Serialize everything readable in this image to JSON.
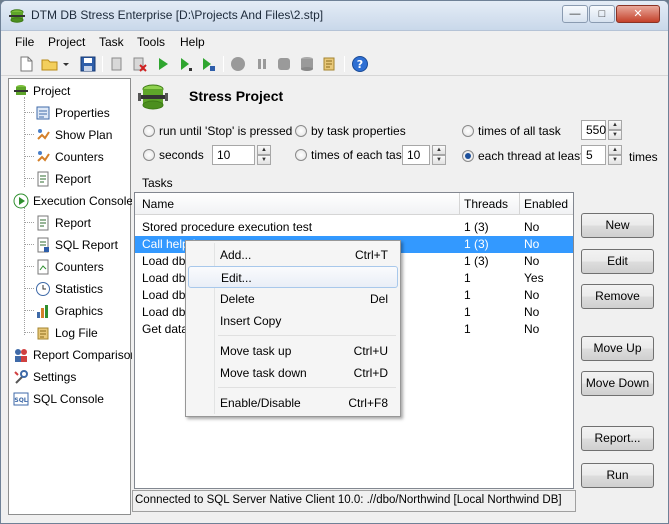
{
  "window": {
    "title": "DTM DB Stress Enterprise [D:\\Projects And Files\\2.stp]",
    "minimize_label": "—",
    "maximize_label": "□",
    "close_label": "✕"
  },
  "menu": [
    "File",
    "Project",
    "Task",
    "Tools",
    "Help"
  ],
  "tree": {
    "items": [
      {
        "label": "Project"
      },
      {
        "label": "Properties"
      },
      {
        "label": "Show Plan"
      },
      {
        "label": "Counters"
      },
      {
        "label": "Report"
      },
      {
        "label": "Execution Console"
      },
      {
        "label": "Report"
      },
      {
        "label": "SQL Report"
      },
      {
        "label": "Counters"
      },
      {
        "label": "Statistics"
      },
      {
        "label": "Graphics"
      },
      {
        "label": "Log File"
      },
      {
        "label": "Report Comparison"
      },
      {
        "label": "Settings"
      },
      {
        "label": "SQL Console"
      }
    ]
  },
  "panel": {
    "title": "Stress Project",
    "options": {
      "run_until_stop": "run until 'Stop' is pressed",
      "by_task_properties": "by task properties",
      "times_of_all_task": "times of all task",
      "times_of_all_task_value": "550",
      "seconds": "seconds",
      "seconds_value": "10",
      "times_of_each_task": "times of each task",
      "times_of_each_task_value": "10",
      "each_thread_at_least": "each thread at least",
      "each_thread_value": "5",
      "times_suffix": "times"
    },
    "tasks_label": "Tasks",
    "columns": [
      "Name",
      "Threads",
      "Enabled"
    ],
    "rows": [
      {
        "name": "Stored procedure execution test",
        "threads": "1 (3)",
        "enabled": "No"
      },
      {
        "name": "Call helpd",
        "threads": "1 (3)",
        "enabled": "No"
      },
      {
        "name": "Load db t",
        "threads": "1 (3)",
        "enabled": "No"
      },
      {
        "name": "Load db t",
        "threads": "1",
        "enabled": "Yes"
      },
      {
        "name": "Load db t",
        "threads": "1",
        "enabled": "No"
      },
      {
        "name": "Load db t",
        "threads": "1",
        "enabled": "No"
      },
      {
        "name": "Get data",
        "threads": "1",
        "enabled": "No"
      }
    ],
    "buttons": {
      "new": "New",
      "edit": "Edit",
      "remove": "Remove",
      "move_up": "Move Up",
      "move_down": "Move Down",
      "report": "Report...",
      "run": "Run"
    },
    "status": "Connected to SQL Server Native Client 10.0: .//dbo/Northwind [Local Northwind DB]"
  },
  "context_menu": [
    {
      "label": "Add...",
      "shortcut": "Ctrl+T"
    },
    {
      "label": "Edit...",
      "shortcut": ""
    },
    {
      "label": "Delete",
      "shortcut": "Del"
    },
    {
      "label": "Insert Copy",
      "shortcut": ""
    },
    {
      "label": "Move task up",
      "shortcut": "Ctrl+U"
    },
    {
      "label": "Move task down",
      "shortcut": "Ctrl+D"
    },
    {
      "label": "Enable/Disable",
      "shortcut": "Ctrl+F8"
    }
  ]
}
